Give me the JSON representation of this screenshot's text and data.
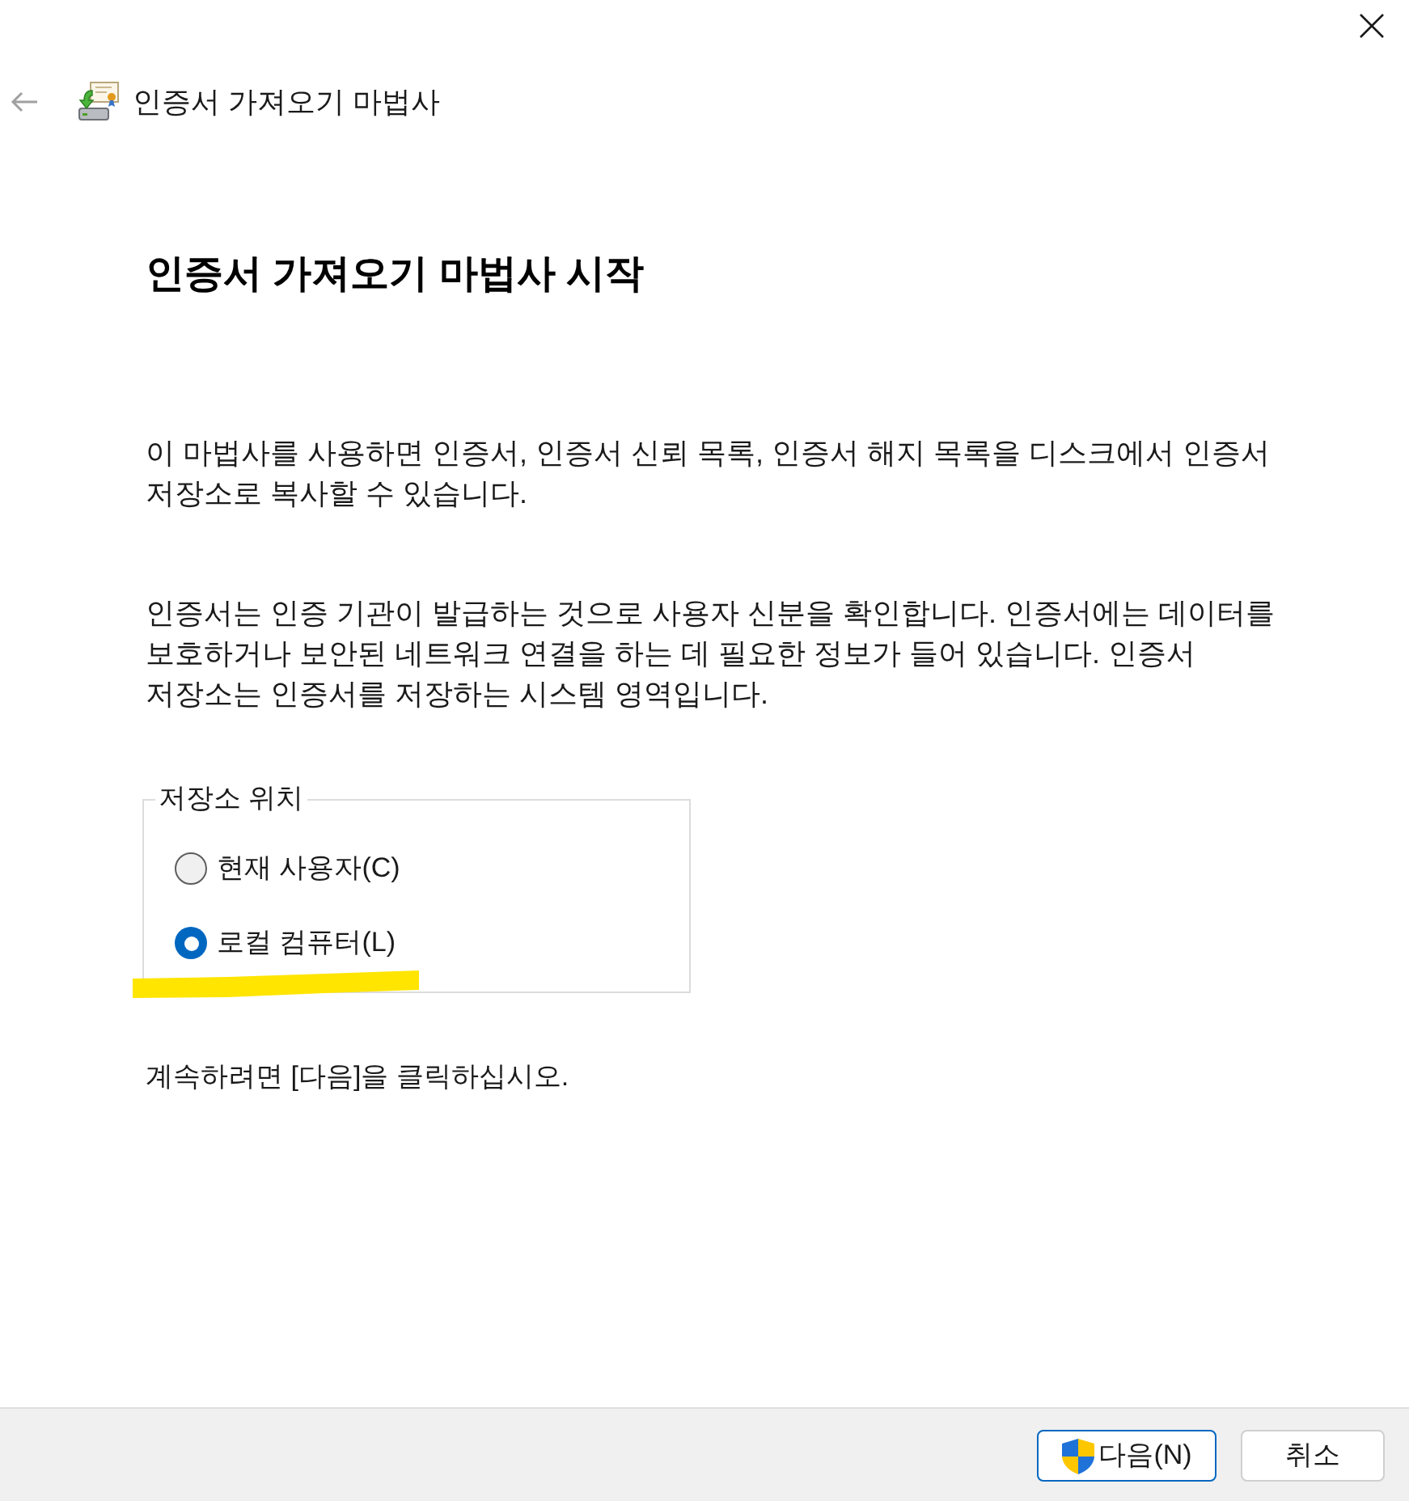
{
  "header": {
    "back_button": {
      "disabled": true
    },
    "title": "인증서 가져오기 마법사"
  },
  "page": {
    "heading": "인증서 가져오기 마법사 시작",
    "paragraphs": [
      "이 마법사를 사용하면 인증서, 인증서 신뢰 목록, 인증서 해지 목록을 디스크에서 인증서 저장소로 복사할 수 있습니다.",
      "인증서는 인증 기관이 발급하는 것으로 사용자 신분을 확인합니다. 인증서에는 데이터를 보호하거나 보안된 네트워크 연결을 하는 데 필요한 정보가 들어 있습니다. 인증서 저장소는 인증서를 저장하는 시스템 영역입니다."
    ]
  },
  "store_location": {
    "legend": "저장소 위치",
    "options": [
      {
        "label": "현재 사용자(C)",
        "selected": false,
        "highlighted": false
      },
      {
        "label": "로컬 컴퓨터(L)",
        "selected": true,
        "highlighted": true
      }
    ]
  },
  "instruction": "계속하려면 [다음]을 클릭하십시오.",
  "buttons": [
    {
      "label": "다음(N)",
      "kind": "shield",
      "default": true
    },
    {
      "label": "취소",
      "kind": "plain",
      "default": false
    }
  ]
}
